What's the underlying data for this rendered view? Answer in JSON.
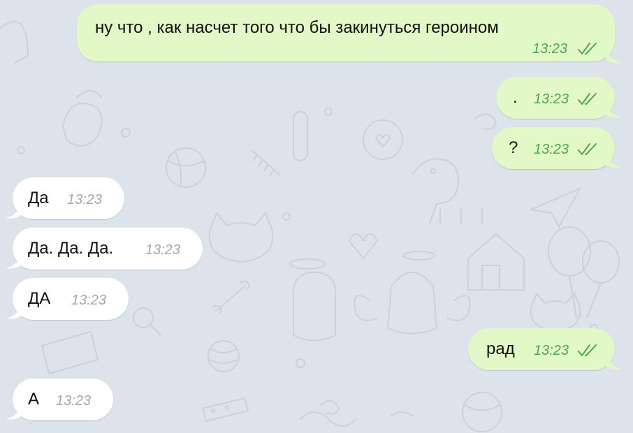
{
  "messages": [
    {
      "text": "ну что , как насчет того что бы закинуться героином",
      "time": "13:23",
      "direction": "outgoing",
      "status": "read"
    },
    {
      "text": ".",
      "time": "13:23",
      "direction": "outgoing",
      "status": "read"
    },
    {
      "text": "?",
      "time": "13:23",
      "direction": "outgoing",
      "status": "read"
    },
    {
      "text": "Да",
      "time": "13:23",
      "direction": "incoming"
    },
    {
      "text": "Да. Да. Да.",
      "time": "13:23",
      "direction": "incoming"
    },
    {
      "text": "ДА",
      "time": "13:23",
      "direction": "incoming"
    },
    {
      "text": "рад",
      "time": "13:23",
      "direction": "outgoing",
      "status": "read"
    },
    {
      "text": "А",
      "time": "13:23",
      "direction": "incoming"
    }
  ],
  "theme": {
    "background": "#dde3ea",
    "incoming_bubble": "#ffffff",
    "outgoing_bubble": "#e3f8c7",
    "outgoing_time": "#4ea64c",
    "incoming_time": "#a1a8ae",
    "pattern": "doodle-line-art"
  },
  "icons": {
    "read_receipt": "double-check-icon"
  }
}
